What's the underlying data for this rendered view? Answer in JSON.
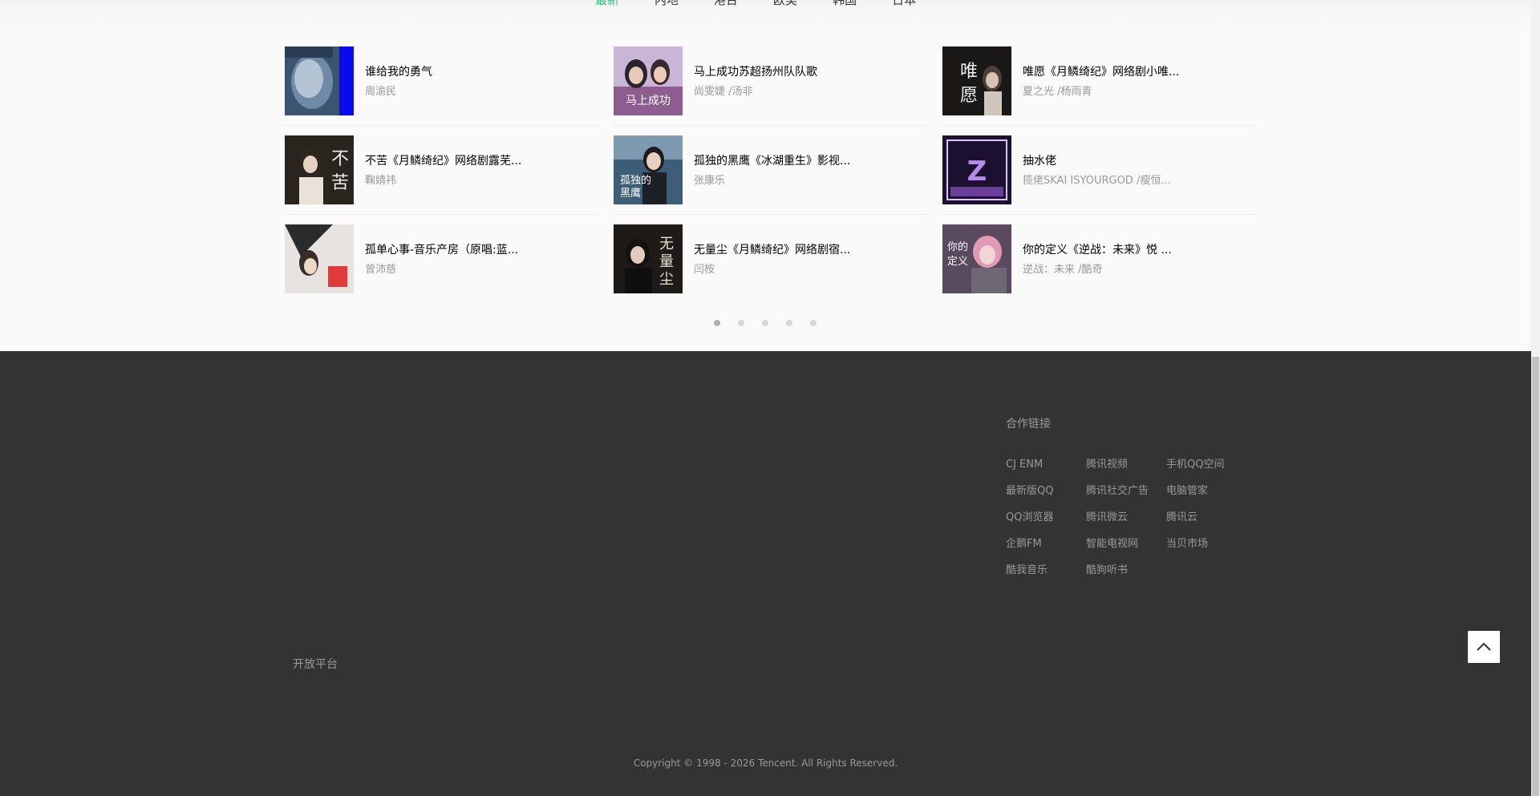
{
  "tabs": [
    {
      "label": "最新",
      "active": true
    },
    {
      "label": "内地"
    },
    {
      "label": "港台"
    },
    {
      "label": "欧美"
    },
    {
      "label": "韩国"
    },
    {
      "label": "日本"
    }
  ],
  "songs": [
    {
      "title": "谁给我的勇气",
      "artist": "周渝民"
    },
    {
      "title": "马上成功苏超扬州队队歌",
      "artist": "尚雯婕 /汤非"
    },
    {
      "title": "唯愿《月鳞绮纪》网络剧小唯...",
      "artist": "夏之光 /杨雨青"
    },
    {
      "title": "不苦《月鳞绮纪》网络剧露芜...",
      "artist": "鞠婧祎"
    },
    {
      "title": "孤独的黑鹰《冰湖重生》影视...",
      "artist": "张康乐"
    },
    {
      "title": "抽水佬",
      "artist": "揽佬SKAI ISYOURGOD /瘦恒..."
    },
    {
      "title": "孤单心事-音乐产房（原唱:蓝...",
      "artist": "曾沛慈"
    },
    {
      "title": "无量尘《月鳞绮纪》网络剧宿...",
      "artist": "闫桉"
    },
    {
      "title": "你的定义《逆战：未来》悦 ...",
      "artist": "逆战：未来 /酷奇"
    }
  ],
  "pagination": {
    "count": 5,
    "active": 0
  },
  "footer": {
    "links_title": "合作链接",
    "links": [
      "CJ ENM",
      "腾讯视频",
      "手机QQ空间",
      "最新版QQ",
      "腾讯社交广告",
      "电脑管家",
      "QQ浏览器",
      "腾讯微云",
      "腾讯云",
      "企鹅FM",
      "智能电视网",
      "当贝市场",
      "酷我音乐",
      "酷狗听书"
    ],
    "open_platform": "开放平台",
    "copyright": "Copyright © 1998 - 2026 Tencent. All Rights Reserved."
  },
  "icons": {
    "back_to_top": "chevron-up-icon"
  },
  "colors": {
    "accent": "#31c27c",
    "footer_bg": "#333333"
  }
}
